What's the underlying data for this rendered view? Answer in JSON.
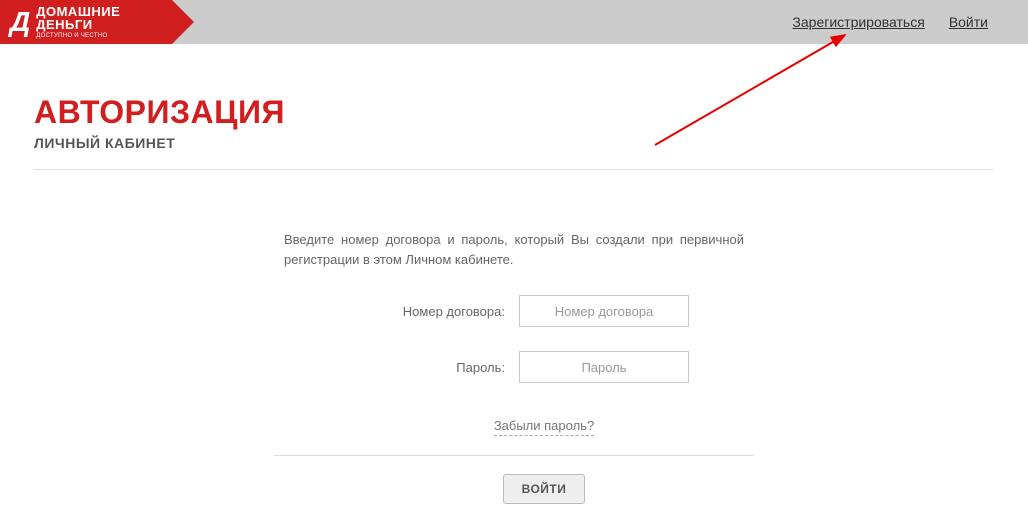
{
  "logo": {
    "icon_text": "Д",
    "line1": "ДОМАШНИЕ",
    "line2": "ДЕНЬГИ",
    "tagline": "ДОСТУПНО И ЧЕСТНО"
  },
  "top_nav": {
    "register": "Зарегистрироваться",
    "login": "Войти"
  },
  "page": {
    "title": "АВТОРИЗАЦИЯ",
    "subtitle": "ЛИЧНЫЙ КАБИНЕТ"
  },
  "form": {
    "instructions": "Введите номер договора и пароль, который Вы создали при первичной регистрации в этом Личном кабинете.",
    "contract_label": "Номер договора:",
    "contract_placeholder": "Номер договора",
    "password_label": "Пароль:",
    "password_placeholder": "Пароль",
    "forgot": "Забыли пароль?",
    "submit": "ВОЙТИ"
  },
  "colors": {
    "brand_red": "#d11e1e",
    "topbar_gray": "#cccccc"
  }
}
